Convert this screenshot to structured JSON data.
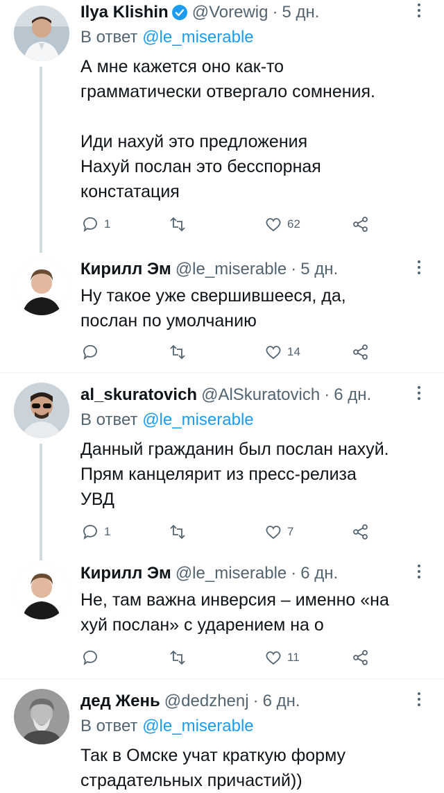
{
  "tweets": [
    {
      "name": "Ilya Klishin",
      "verified": true,
      "handle": "@Vorewig",
      "dot": "·",
      "time": "5 дн.",
      "reply_prefix": "В ответ",
      "reply_mention": "@le_miserable",
      "text": "А мне кажется оно как-то\nграмматически отвергало сомнения.\n\nИди нахуй это предложения\nНахуй послан это бесспорная\nконстатация",
      "replies": "1",
      "retweets": "",
      "likes": "62"
    },
    {
      "name": "Кирилл Эм",
      "handle": "@le_miserable",
      "dot": "·",
      "time": "5 дн.",
      "text": "Ну такое уже свершившееся, да,\nпослан по умолчанию",
      "replies": "",
      "retweets": "",
      "likes": "14"
    },
    {
      "name": "al_skuratovich",
      "handle": "@AlSkuratovich",
      "dot": "·",
      "time": "6 дн.",
      "reply_prefix": "В ответ",
      "reply_mention": "@le_miserable",
      "text": "Данный гражданин был послан нахуй.\nПрям канцелярит из пресс-релиза\nУВД",
      "replies": "1",
      "retweets": "",
      "likes": "7"
    },
    {
      "name": "Кирилл Эм",
      "handle": "@le_miserable",
      "dot": "·",
      "time": "6 дн.",
      "text": "Не, там важна инверсия – именно «на\nхуй послан» с ударением на о",
      "replies": "",
      "retweets": "",
      "likes": "11"
    },
    {
      "name": "дед Жень",
      "handle": "@dedzhenj",
      "dot": "·",
      "time": "6 дн.",
      "reply_prefix": "В ответ",
      "reply_mention": "@le_miserable",
      "text": "Так в Омске учат краткую форму\nстрадательных причастий))"
    }
  ],
  "colors": {
    "text": "#0f1419",
    "secondary": "#536471",
    "link": "#1d9bf0",
    "verified": "#1d9bf0",
    "thread_line": "#cfd9de",
    "divider": "#eff3f4"
  },
  "icons": {
    "reply": "speech-bubble-icon",
    "retweet": "retweet-arrows-icon",
    "like": "heart-outline-icon",
    "share": "share-nodes-icon",
    "more": "vertical-ellipsis-icon",
    "verified": "verified-badge-icon"
  }
}
